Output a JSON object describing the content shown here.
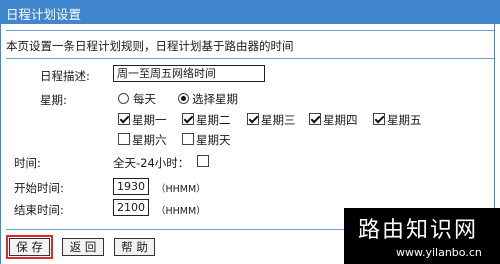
{
  "window": {
    "title": "日程计划设置"
  },
  "hint": "本页设置一条日程计划规则，日程计划基于路由器的时间",
  "form": {
    "desc_label": "日程描述:",
    "desc_value": "周一至周五网络时间",
    "week_label": "星期:",
    "radio_everyday": "每天",
    "radio_select": "选择星期",
    "days": [
      "星期一",
      "星期二",
      "星期三",
      "星期四",
      "星期五",
      "星期六",
      "星期天"
    ],
    "days_checked": [
      true,
      true,
      true,
      true,
      true,
      false,
      false
    ],
    "time_label": "时间:",
    "allday_label": "全天-24小时：",
    "start_label": "开始时间:",
    "start_value": "1930",
    "start_hint": "（HHMM）",
    "end_label": "结束时间:",
    "end_value": "2100",
    "end_hint": "（HHMM）"
  },
  "buttons": {
    "save": "保 存",
    "back": "返 回",
    "help": "帮 助"
  },
  "watermark": {
    "title": "路由知识网",
    "url": "www.yilanbo.cn"
  }
}
